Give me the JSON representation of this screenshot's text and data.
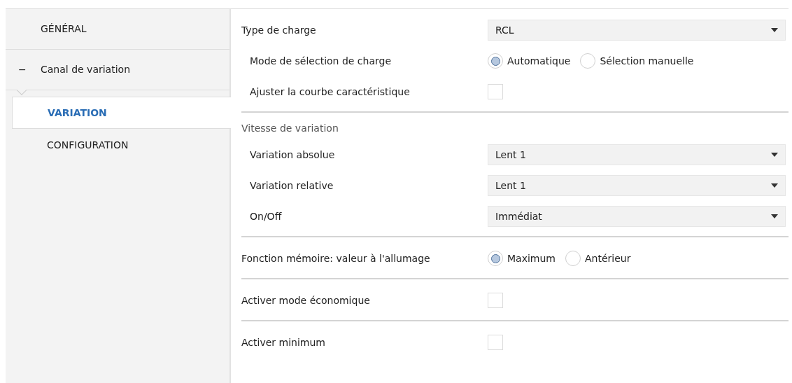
{
  "sidebar": {
    "items": [
      {
        "label": "GÉNÉRAL",
        "selected": false
      },
      {
        "label": "Canal de variation",
        "expanded": true,
        "toggle": "−",
        "selected": false,
        "children": [
          {
            "label": "VARIATION",
            "selected": true
          },
          {
            "label": "CONFIGURATION",
            "selected": false
          }
        ]
      }
    ]
  },
  "sections": [
    {
      "rows": [
        {
          "kind": "dropdown",
          "label": "Type de charge",
          "value": "RCL",
          "children": [
            {
              "kind": "radio",
              "label": "Mode de sélection de charge",
              "options": [
                {
                  "label": "Automatique",
                  "selected": true
                },
                {
                  "label": "Sélection manuelle",
                  "selected": false
                }
              ]
            },
            {
              "kind": "checkbox",
              "label": "Ajuster la courbe caractéristique",
              "checked": false
            }
          ]
        }
      ]
    },
    {
      "heading": "Vitesse de variation",
      "rows": [
        {
          "kind": "dropdown",
          "label": "Variation absolue",
          "value": "Lent 1"
        },
        {
          "kind": "dropdown",
          "label": "Variation relative",
          "value": "Lent 1"
        },
        {
          "kind": "dropdown",
          "label": "On/Off",
          "value": "Immédiat"
        }
      ]
    },
    {
      "rows": [
        {
          "kind": "radio",
          "label": "Fonction mémoire: valeur à l'allumage",
          "options": [
            {
              "label": "Maximum",
              "selected": true
            },
            {
              "label": "Antérieur",
              "selected": false
            }
          ]
        }
      ]
    },
    {
      "rows": [
        {
          "kind": "checkbox",
          "label": "Activer mode économique",
          "checked": false
        }
      ]
    },
    {
      "rows": [
        {
          "kind": "checkbox",
          "label": "Activer minimum",
          "checked": false
        }
      ]
    }
  ]
}
